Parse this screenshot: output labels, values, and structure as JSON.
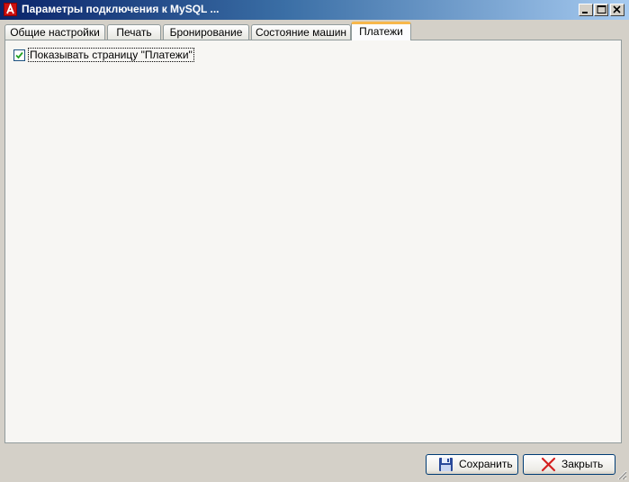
{
  "window": {
    "title": "Параметры подключения к MySQL ..."
  },
  "tabs": [
    {
      "label": "Общие настройки"
    },
    {
      "label": "Печать"
    },
    {
      "label": "Бронирование"
    },
    {
      "label": "Состояние машин"
    },
    {
      "label": "Платежи",
      "active": true
    }
  ],
  "payments": {
    "show_page_label": "Показывать страницу \"Платежи\"",
    "show_page_checked": true
  },
  "buttons": {
    "save_label": "Сохранить",
    "close_label": "Закрыть"
  },
  "colors": {
    "titlebar_start": "#0a246a",
    "titlebar_end": "#a6caf0",
    "active_tab_accent": "#f7b74b",
    "checkmark": "#21a121",
    "save_icon": "#2a4a9a",
    "close_icon": "#d42020"
  },
  "icons": {
    "app": "app-logo-icon",
    "save": "floppy-disk-icon",
    "close": "red-x-icon"
  }
}
